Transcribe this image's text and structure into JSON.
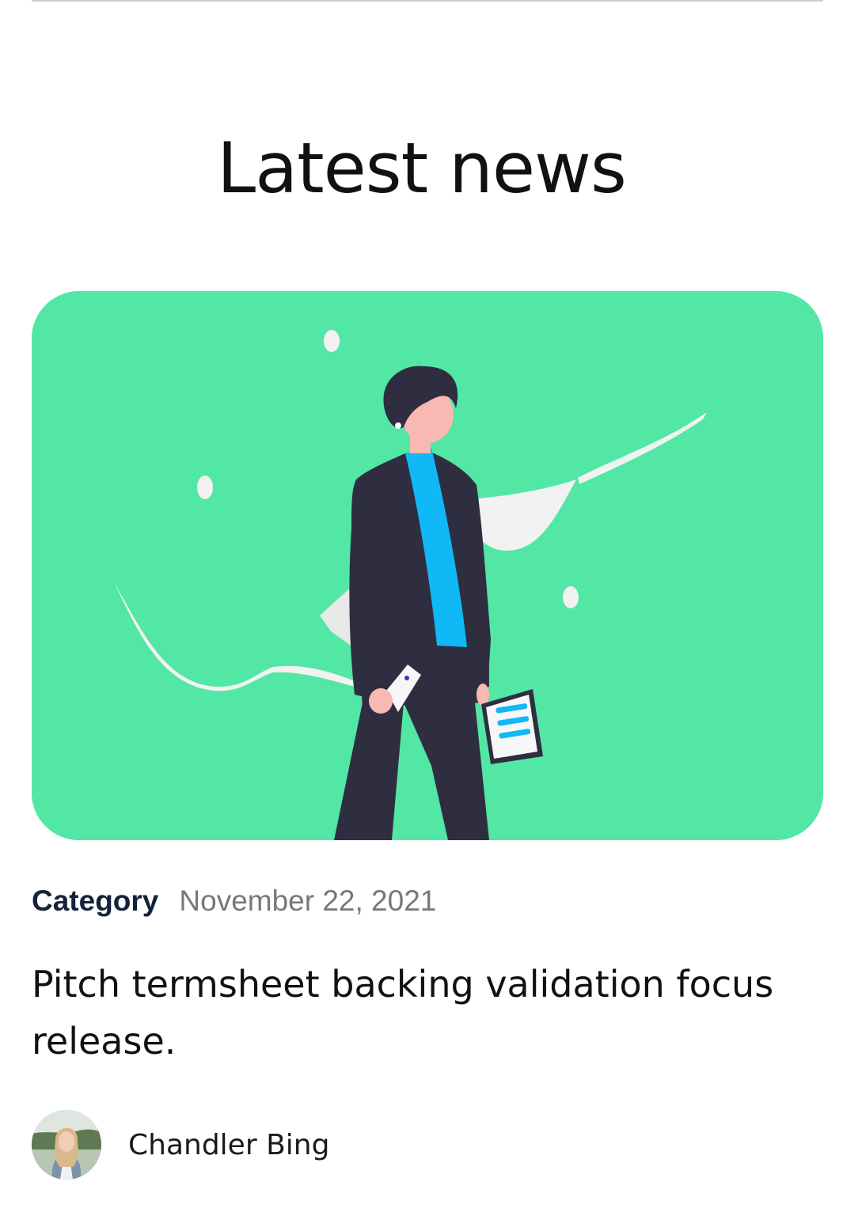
{
  "section": {
    "title": "Latest news"
  },
  "article": {
    "image_name": "person-walking-illustration",
    "category": "Category",
    "date": "November 22, 2021",
    "headline": "Pitch termsheet backing validation focus release.",
    "author": {
      "name": "Chandler Bing"
    }
  },
  "colors": {
    "hero_background": "#52e7a4",
    "category_text": "#14233a",
    "date_text": "#76787c",
    "figure_suit": "#2f2e41",
    "figure_scarf": "#10b8f6",
    "figure_skin": "#f9b9b3",
    "accent_white": "#f2f2f2"
  }
}
